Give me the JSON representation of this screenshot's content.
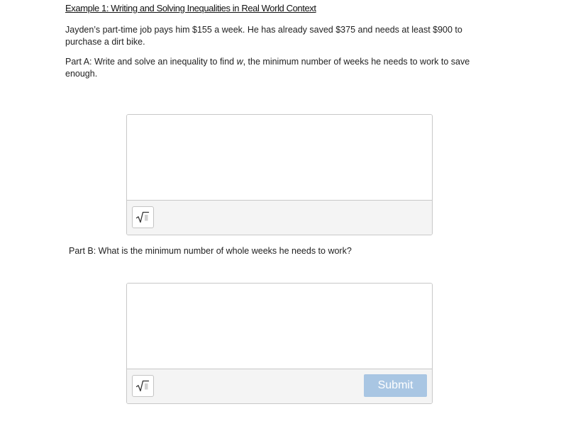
{
  "example": {
    "title": "Example 1: Writing and Solving Inequalities in Real World Context",
    "problem_text": "Jayden’s part-time job pays him $155 a week.  He has already saved $375 and needs at least $900 to purchase a dirt bike.",
    "part_a": {
      "prefix": "Part A:  Write and solve an inequality to find ",
      "variable": "w",
      "suffix": ", the minimum number of weeks he needs to work to save enough."
    },
    "part_b": {
      "text": "Part B:  What is the minimum number of whole weeks he needs to work?"
    }
  },
  "answer_a": {
    "value": "",
    "math_icon": "square-root-icon"
  },
  "answer_b": {
    "value": "",
    "math_icon": "square-root-icon"
  },
  "submit": {
    "label": "Submit",
    "color": "#a9c6e3",
    "disabled": true
  }
}
